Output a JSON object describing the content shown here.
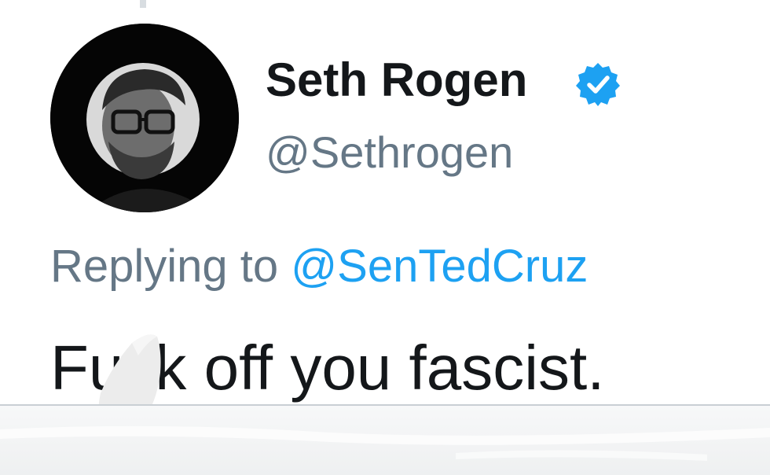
{
  "tweet": {
    "author": {
      "display_name": "Seth Rogen",
      "handle": "@Sethrogen",
      "verified_icon": "verified-badge-icon",
      "avatar_icon": "avatar"
    },
    "reply": {
      "prefix": "Replying to ",
      "target": "@SenTedCruz"
    },
    "text": "Fuck off you fascist."
  },
  "colors": {
    "name": "#14171a",
    "secondary": "#657786",
    "link": "#1da1f2",
    "verified": "#1da1f2",
    "avatar_bg": "#050505"
  }
}
